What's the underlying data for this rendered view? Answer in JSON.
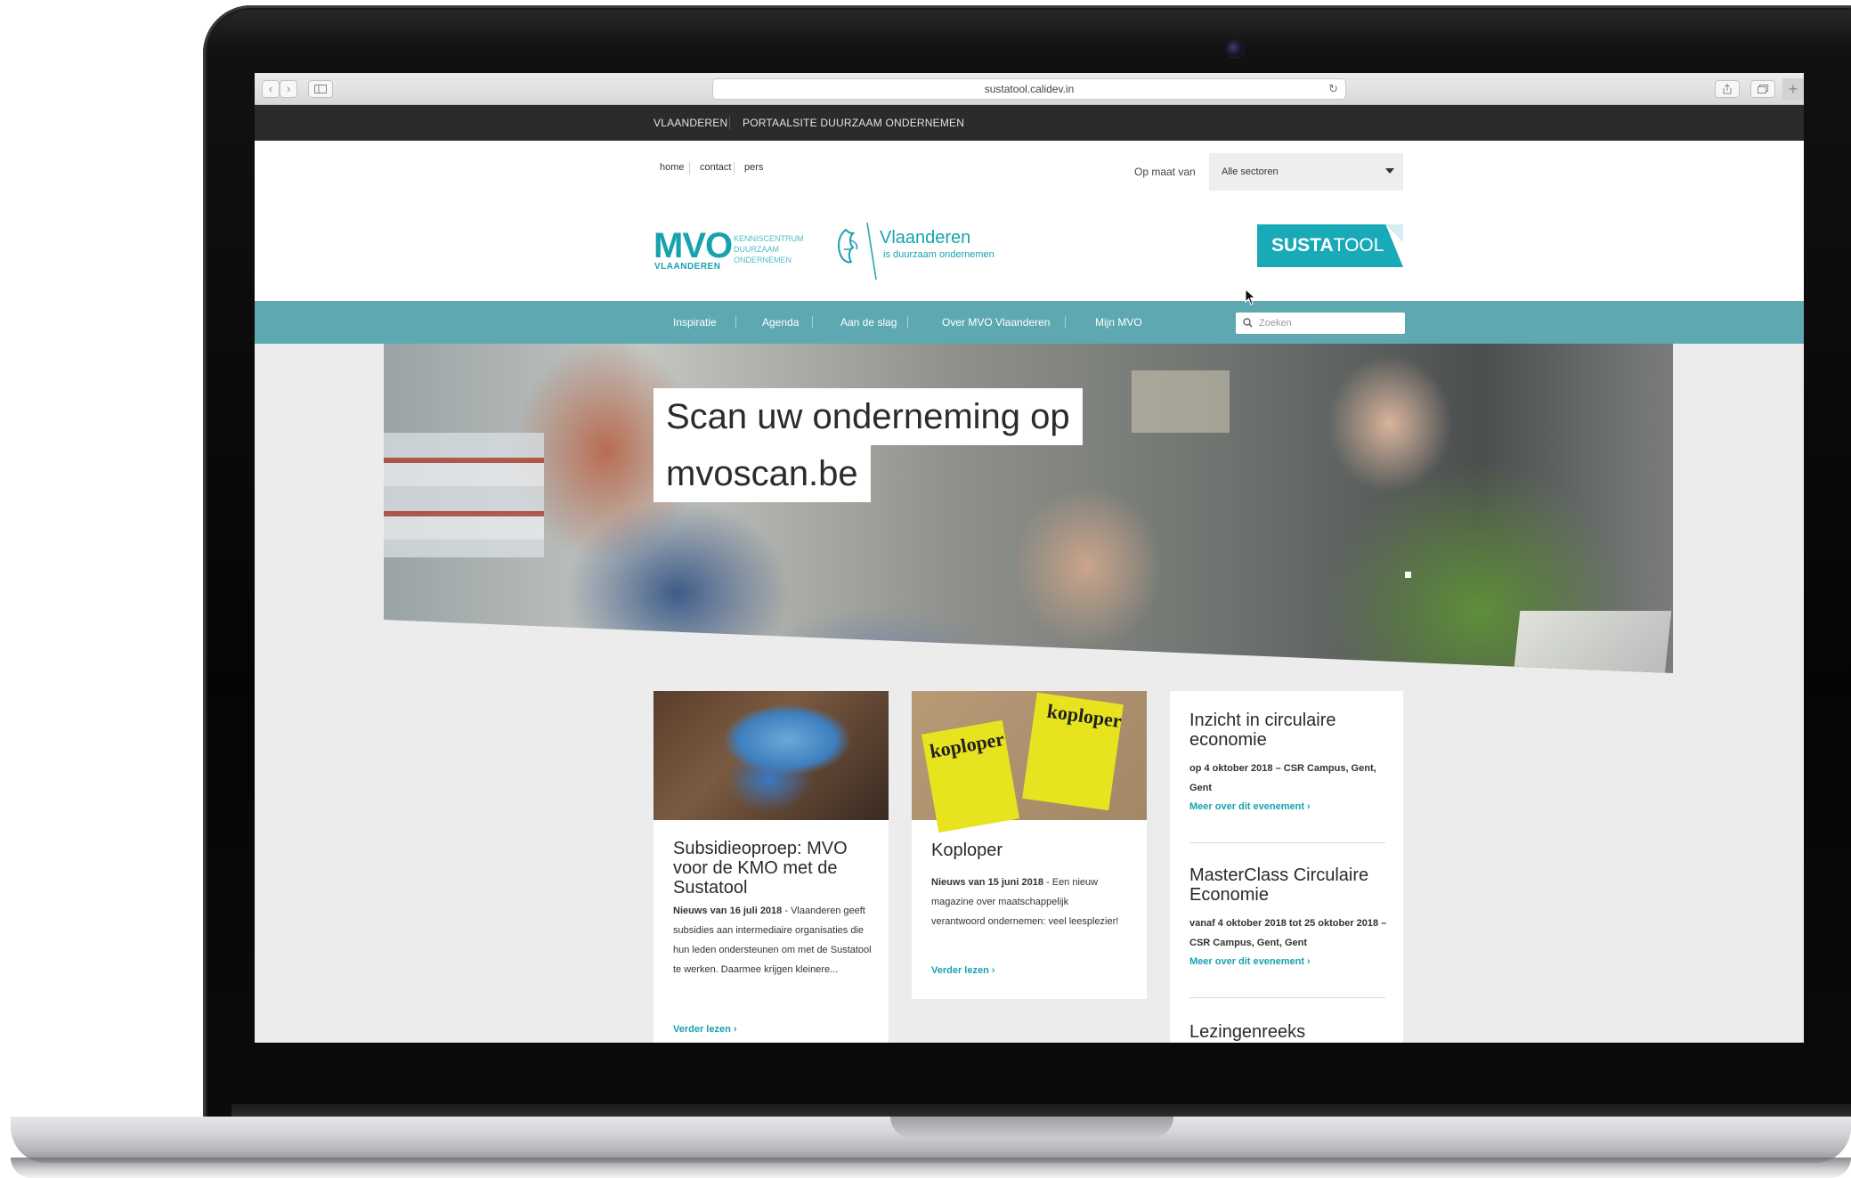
{
  "browser": {
    "url": "sustatool.calidev.in",
    "back_label": "‹",
    "forward_label": "›",
    "reload_glyph": "↻"
  },
  "topbar": {
    "items": [
      "VLAANDEREN",
      "PORTAALSITE DUURZAAM ONDERNEMEN"
    ]
  },
  "header": {
    "util_links": [
      "home",
      "contact",
      "pers"
    ],
    "op_maat_label": "Op maat van",
    "sector_select": "Alle sectoren",
    "mvo_logo": "MVO",
    "mvo_logo_sub": "VLAANDEREN",
    "mvo_tagline": "KENNISCENTRUM DUURZAAM ONDERNEMEN",
    "vlaanderen_title": "Vlaanderen",
    "vlaanderen_sub": "is duurzaam ondernemen",
    "sustatool_bold": "SUSTA",
    "sustatool_rest": "TOOL"
  },
  "nav": {
    "items": [
      "Inspiratie",
      "Agenda",
      "Aan de slag",
      "Over MVO Vlaanderen",
      "Mijn MVO"
    ],
    "search_placeholder": "Zoeken"
  },
  "hero": {
    "caption_line1": "Scan uw onderneming op",
    "caption_line2": "mvoscan.be"
  },
  "cards": [
    {
      "title": "Subsidieoproep: MVO voor de KMO met de Sustatool",
      "meta": "Nieuws van 16 juli 2018",
      "text": " - Vlaanderen geeft subsidies aan intermediaire organisaties die hun leden ondersteunen om met de Sustatool te werken. Daarmee krijgen kleinere...",
      "link": "Verder lezen ›"
    },
    {
      "title": "Koploper",
      "meta": "Nieuws van 15 juni 2018",
      "text": " - Een nieuw magazine over maatschappelijk verantwoord ondernemen: veel leesplezier!",
      "link": "Verder lezen ›",
      "magazine_title": "koploper"
    }
  ],
  "events": [
    {
      "title": "Inzicht in circulaire economie",
      "meta": "op 4 oktober 2018 – CSR Campus, Gent, Gent",
      "link": "Meer over dit evenement ›"
    },
    {
      "title": "MasterClass Circulaire Economie",
      "meta": "vanaf 4 oktober 2018 tot 25 oktober 2018 – CSR Campus, Gent, Gent",
      "link": "Meer over dit evenement ›"
    },
    {
      "title": "Lezingenreeks"
    }
  ],
  "colors": {
    "accent": "#17a2b0",
    "nav_bg": "#5ea9b1",
    "topbar_bg": "#2b2b2b"
  }
}
